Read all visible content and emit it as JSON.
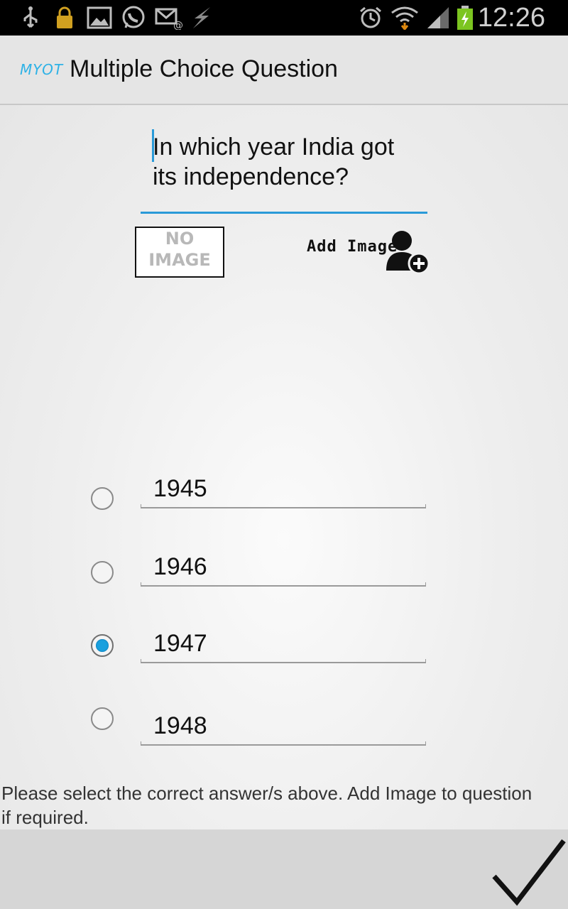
{
  "status_bar": {
    "time": "12:26",
    "left_icons": [
      "usb-icon",
      "lock-icon",
      "gallery-icon",
      "whatsapp-icon",
      "email-icon",
      "flash-icon"
    ],
    "right_icons": [
      "alarm-icon",
      "wifi-icon",
      "signal-icon",
      "battery-icon"
    ],
    "colors": {
      "icon": "#d0a020",
      "battery": "#7cc520"
    }
  },
  "action_bar": {
    "logo": "MYOT",
    "title": "Multiple Choice Question"
  },
  "question": {
    "text": "In which year India got its independence?"
  },
  "image_placeholder": {
    "line1": "NO",
    "line2": "IMAGE"
  },
  "add_image": {
    "label": "Add Image"
  },
  "options": [
    {
      "value": "1945",
      "selected": false
    },
    {
      "value": "1946",
      "selected": false
    },
    {
      "value": "1947",
      "selected": true
    },
    {
      "value": "1948",
      "selected": false
    }
  ],
  "hint": "Please select the correct answer/s above. Add Image to question if required.",
  "colors": {
    "accent": "#2a9ad8",
    "radio_selected": "#1aa0de"
  }
}
